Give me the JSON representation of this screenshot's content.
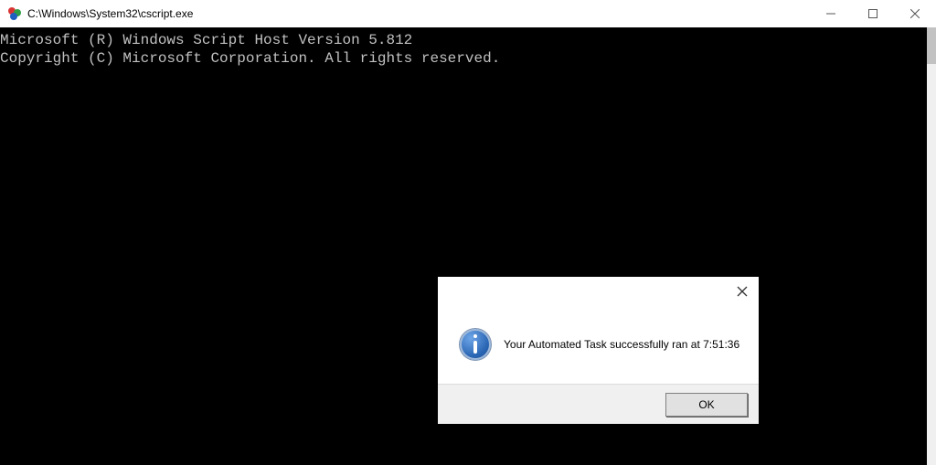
{
  "window": {
    "title": "C:\\Windows\\System32\\cscript.exe"
  },
  "console": {
    "line1": "Microsoft (R) Windows Script Host Version 5.812",
    "line2": "Copyright (C) Microsoft Corporation. All rights reserved."
  },
  "dialog": {
    "message": "Your Automated Task successfully ran at 7:51:36",
    "ok_label": "OK"
  }
}
